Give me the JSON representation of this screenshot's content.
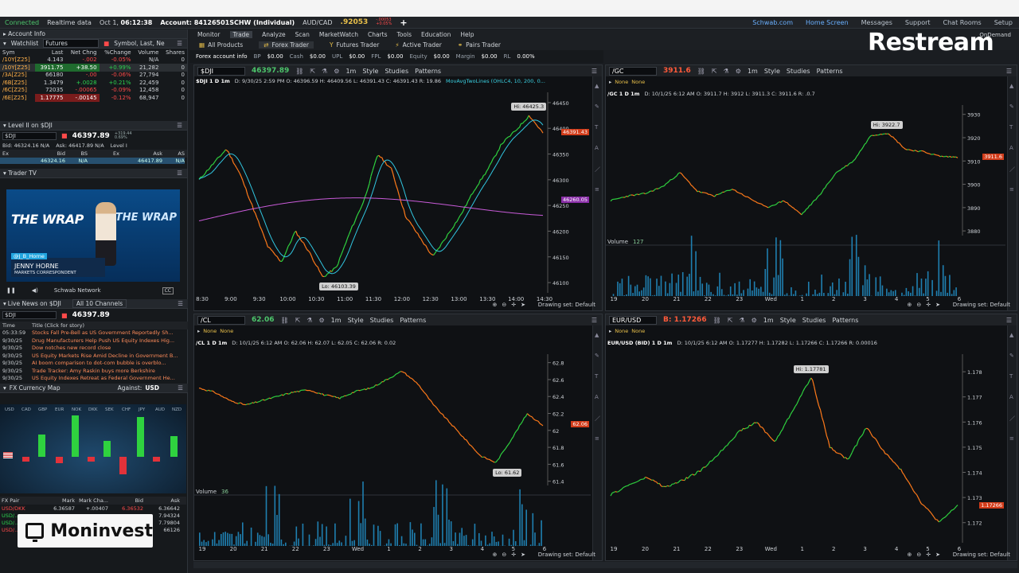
{
  "topbar": {
    "status": "Connected",
    "realtime": "Realtime data",
    "date": "Oct 1,",
    "time": "06:12:38",
    "account": "Account: 84126501SCHW (Individual)",
    "pair": "AUD/CAD",
    "pair_price": ".92053",
    "pair_chg1": "-.00053",
    "pair_chg2": "+0.05%",
    "add": "+"
  },
  "top_links": [
    "Schwab.com",
    "Home Screen",
    "Messages",
    "Support",
    "Chat Rooms",
    "Setup"
  ],
  "menu": [
    "Monitor",
    "Trade",
    "Analyze",
    "Scan",
    "MarketWatch",
    "Charts",
    "Tools",
    "Education",
    "Help"
  ],
  "menu_selected": "Trade",
  "tabs": [
    "All Products",
    "Forex Trader",
    "Futures Trader",
    "Active Trader",
    "Pairs Trader"
  ],
  "tab_selected": "Forex Trader",
  "acct": {
    "label": "Forex account info",
    "items": [
      [
        "BP",
        "$0.00"
      ],
      [
        "Cash",
        "$0.00"
      ],
      [
        "UPL",
        "$0.00"
      ],
      [
        "FPL",
        "$0.00"
      ],
      [
        "Equity",
        "$0.00"
      ],
      [
        "Margin",
        "$0.00"
      ],
      [
        "RL",
        "0.00%"
      ]
    ]
  },
  "brand": {
    "restream": "Restream",
    "moninvest": "Moninvest",
    "ondemand": "OnDemand"
  },
  "left": {
    "account_info": "Account Info",
    "watchlist": "Watchlist",
    "watchlist_sel": "Futures",
    "watchlist_cols": "Symbol, Last, Ne",
    "wl_headers": [
      "Sym",
      "Last",
      "Net Chng",
      "%Change",
      "Volume",
      "Shares"
    ],
    "wl_rows": [
      [
        "/10Y[Z25]",
        "4.143",
        "-.002",
        "-0.05%",
        "N/A",
        "0"
      ],
      [
        "/10Y[Z25]",
        "3911.75",
        "+38.50",
        "+0.99%",
        "21,282",
        "0"
      ],
      [
        "/3A[Z25]",
        "66180",
        "-.00",
        "-0.06%",
        "27,794",
        "0"
      ],
      [
        "/6B[Z25]",
        "1.3479",
        "+.0028",
        "+0.21%",
        "22,459",
        "0"
      ],
      [
        "/6C[Z25]",
        "72035",
        "-.00065",
        "-0.09%",
        "12,458",
        "0"
      ],
      [
        "/6E[Z25]",
        "1.17775",
        "-.00145",
        "-0.12%",
        "68,947",
        "0"
      ]
    ],
    "level2": "Level II on $DJI",
    "l2_sym": "$DJI",
    "l2_price": "46397.89",
    "l2_chg": "+319.44",
    "l2_pct": "0.69%",
    "l2_bid": "Bid: 46324.16 N/A",
    "l2_ask": "Ask: 46417.89 N/A",
    "l2_level": "Level I",
    "l2_headers": [
      "Ex",
      "Bid",
      "BS",
      "Ex",
      "Ask",
      "AS"
    ],
    "l2_row": [
      "46324.16",
      "N/A",
      "46417.89",
      "N/A"
    ],
    "trader_tv": "Trader TV",
    "tv_wrap": "THE WRAP",
    "tv_tag": "@J_B_Horne",
    "tv_name": "JENNY HORNE",
    "tv_role": "MARKETS CORRESPONDENT",
    "tv_channel": "Schwab Network",
    "tv_cc": "CC",
    "news": "Live News on $DJI",
    "news_channels": "All 10 Channels",
    "news_sym": "$DJI",
    "news_price": "46397.89",
    "news_headers": [
      "Time",
      "Title (Click for story)"
    ],
    "news_rows": [
      [
        "05:33:59",
        "Stocks Fall Pre-Bell as US Government Reportedly Sh..."
      ],
      [
        "9/30/25",
        "Drug Manufacturers Help Push US Equity Indexes Hig..."
      ],
      [
        "9/30/25",
        "Dow notches new record close"
      ],
      [
        "9/30/25",
        "US Equity Markets Rise Amid Decline in Government B..."
      ],
      [
        "9/30/25",
        "AI boom comparison to dot-com bubble is overblo..."
      ],
      [
        "9/30/25",
        "Trade Tracker: Amy Raskin buys more Berkshire"
      ],
      [
        "9/30/25",
        "US Equity Indexes Retreat as Federal Government He..."
      ]
    ],
    "fx_map": "FX Currency Map",
    "fx_against": "Against:",
    "fx_base": "USD",
    "fx_ccys": [
      "USD",
      "CAD",
      "GBP",
      "EUR",
      "NOK",
      "DKK",
      "SEK",
      "CHF",
      "JPY",
      "AUD",
      "NZD"
    ],
    "fx_pair_headers": [
      "FX Pair",
      "Mark",
      "Mark Cha...",
      "Bid",
      "Ask"
    ],
    "fx_rows": [
      [
        "USD/DKK",
        "6.36587",
        "+.00407",
        "6.36532",
        "6.36642"
      ],
      [
        "USD/...",
        "",
        "",
        "",
        "7.94324"
      ],
      [
        "USD/...",
        "",
        "",
        "",
        "7.79804"
      ],
      [
        "USD/...",
        "",
        "",
        "",
        "66126"
      ]
    ]
  },
  "charts": {
    "dji": {
      "symbol": "$DJI",
      "price": "46397.89",
      "chg": "+319.44",
      "pct": "+0.69%",
      "hdr": "$DJI 1 D 1m",
      "info": "D: 9/30/25 2:59 PM  O: 46396.59  H: 46409.56  L: 46391.43  C: 46391.43  R: 19.86",
      "study": "MovAvgTwoLines (OHLC4, 10, 200, 0...",
      "hi": "Hi: 46425.3",
      "lo": "Lo: 46103.39",
      "last_tag": "46391.43",
      "ma_tag": "46260.05"
    },
    "gc": {
      "symbol": "/GC",
      "price": "3911.6",
      "hdr": "/GC 1 D 1m",
      "info": "D: 10/1/25 6:12 AM  O: 3911.7  H: 3912  L: 3911.3  C: 3911.6  R: .0.7",
      "hi": "Hi: 3922.7",
      "last_tag": "3911.6",
      "vol_label": "Volume",
      "vol_val": "127"
    },
    "cl": {
      "symbol": "/CL",
      "price": "62.06",
      "hdr": "/CL 1 D 1m",
      "info": "D: 10/1/25 6:12 AM  O: 62.06  H: 62.07  L: 62.05  C: 62.06  R: 0.02",
      "lo": "Lo: 61.62",
      "last_tag": "62.06",
      "vol_label": "Volume",
      "vol_val": "36"
    },
    "eu": {
      "symbol": "EUR/USD",
      "price": "B: 1.17266",
      "hdr": "EUR/USD (BID) 1 D 1m",
      "info": "D: 10/1/25 6:12 AM  O: 1.17277  H: 1.17282  L: 1.17266  C: 1.17266  R: 0.00016",
      "hi": "Hi: 1.17781",
      "last_tag": "1.17266"
    }
  },
  "common": {
    "style": "Style",
    "studies": "Studies",
    "patterns": "Patterns",
    "drawing_set": "Drawing set: Default",
    "interval": "1m",
    "none": "None"
  },
  "chart_data": [
    {
      "type": "line",
      "title": "$DJI 1 D 1m",
      "x_ticks": [
        "8:30",
        "9:00",
        "9:30",
        "10:00",
        "10:30",
        "11:00",
        "11:30",
        "12:00",
        "12:30",
        "13:00",
        "13:30",
        "14:00",
        "14:30"
      ],
      "y_ticks": [
        46450,
        46400,
        46350,
        46300,
        46250,
        46200,
        46150,
        46100
      ],
      "ylim": [
        46080,
        46470
      ],
      "hi": 46425.3,
      "lo": 46103.39,
      "last": 46391.43,
      "ma": 46260.05,
      "series": [
        {
          "values": [
            46300,
            46330,
            46360,
            46310,
            46240,
            46170,
            46140,
            46200,
            46160,
            46110,
            46130,
            46200,
            46260,
            46350,
            46320,
            46230,
            46190,
            46150,
            46190,
            46230,
            46280,
            46320,
            46370,
            46395,
            46425,
            46391
          ]
        }
      ]
    },
    {
      "type": "line",
      "title": "/GC 1 D 1m",
      "x_ticks": [
        "19",
        "20",
        "21",
        "22",
        "23",
        "Wed",
        "1",
        "2",
        "3",
        "4",
        "5",
        "6"
      ],
      "y_ticks": [
        3930,
        3920,
        3910,
        3900,
        3890,
        3880
      ],
      "ylim": [
        3878,
        3934
      ],
      "hi": 3922.7,
      "last": 3911.6,
      "series": [
        {
          "values": [
            3893,
            3895,
            3896,
            3899,
            3905,
            3897,
            3895,
            3898,
            3894,
            3890,
            3893,
            3887,
            3895,
            3905,
            3910,
            3921,
            3922,
            3915,
            3914,
            3912,
            3911.6
          ]
        }
      ]
    },
    {
      "type": "line",
      "title": "/CL 1 D 1m",
      "x_ticks": [
        "19",
        "20",
        "21",
        "22",
        "23",
        "Wed",
        "1",
        "2",
        "3",
        "4",
        "5",
        "6"
      ],
      "y_ticks": [
        62.8,
        62.6,
        62.4,
        62.2,
        62.0,
        61.8,
        61.6,
        61.4
      ],
      "ylim": [
        61.35,
        62.9
      ],
      "lo": 61.62,
      "last": 62.06,
      "series": [
        {
          "values": [
            62.5,
            62.45,
            62.35,
            62.3,
            62.35,
            62.4,
            62.45,
            62.48,
            62.42,
            62.38,
            62.46,
            62.5,
            62.6,
            62.7,
            62.55,
            62.3,
            62.1,
            61.9,
            61.7,
            61.62,
            61.9,
            62.2,
            62.06
          ]
        }
      ]
    },
    {
      "type": "line",
      "title": "EUR/USD (BID) 1 D 1m",
      "x_ticks": [
        "19",
        "20",
        "21",
        "22",
        "23",
        "Wed",
        "1",
        "2",
        "3",
        "4",
        "5",
        "6"
      ],
      "y_ticks": [
        1.178,
        1.177,
        1.176,
        1.175,
        1.174,
        1.173,
        1.172
      ],
      "ylim": [
        1.1712,
        1.1787
      ],
      "hi": 1.17781,
      "last": 1.17266,
      "series": [
        {
          "values": [
            1.1731,
            1.1735,
            1.1738,
            1.1734,
            1.1737,
            1.1741,
            1.1748,
            1.1756,
            1.176,
            1.1752,
            1.1765,
            1.1778,
            1.175,
            1.1745,
            1.1758,
            1.1748,
            1.174,
            1.1728,
            1.172,
            1.1727
          ]
        }
      ]
    }
  ]
}
